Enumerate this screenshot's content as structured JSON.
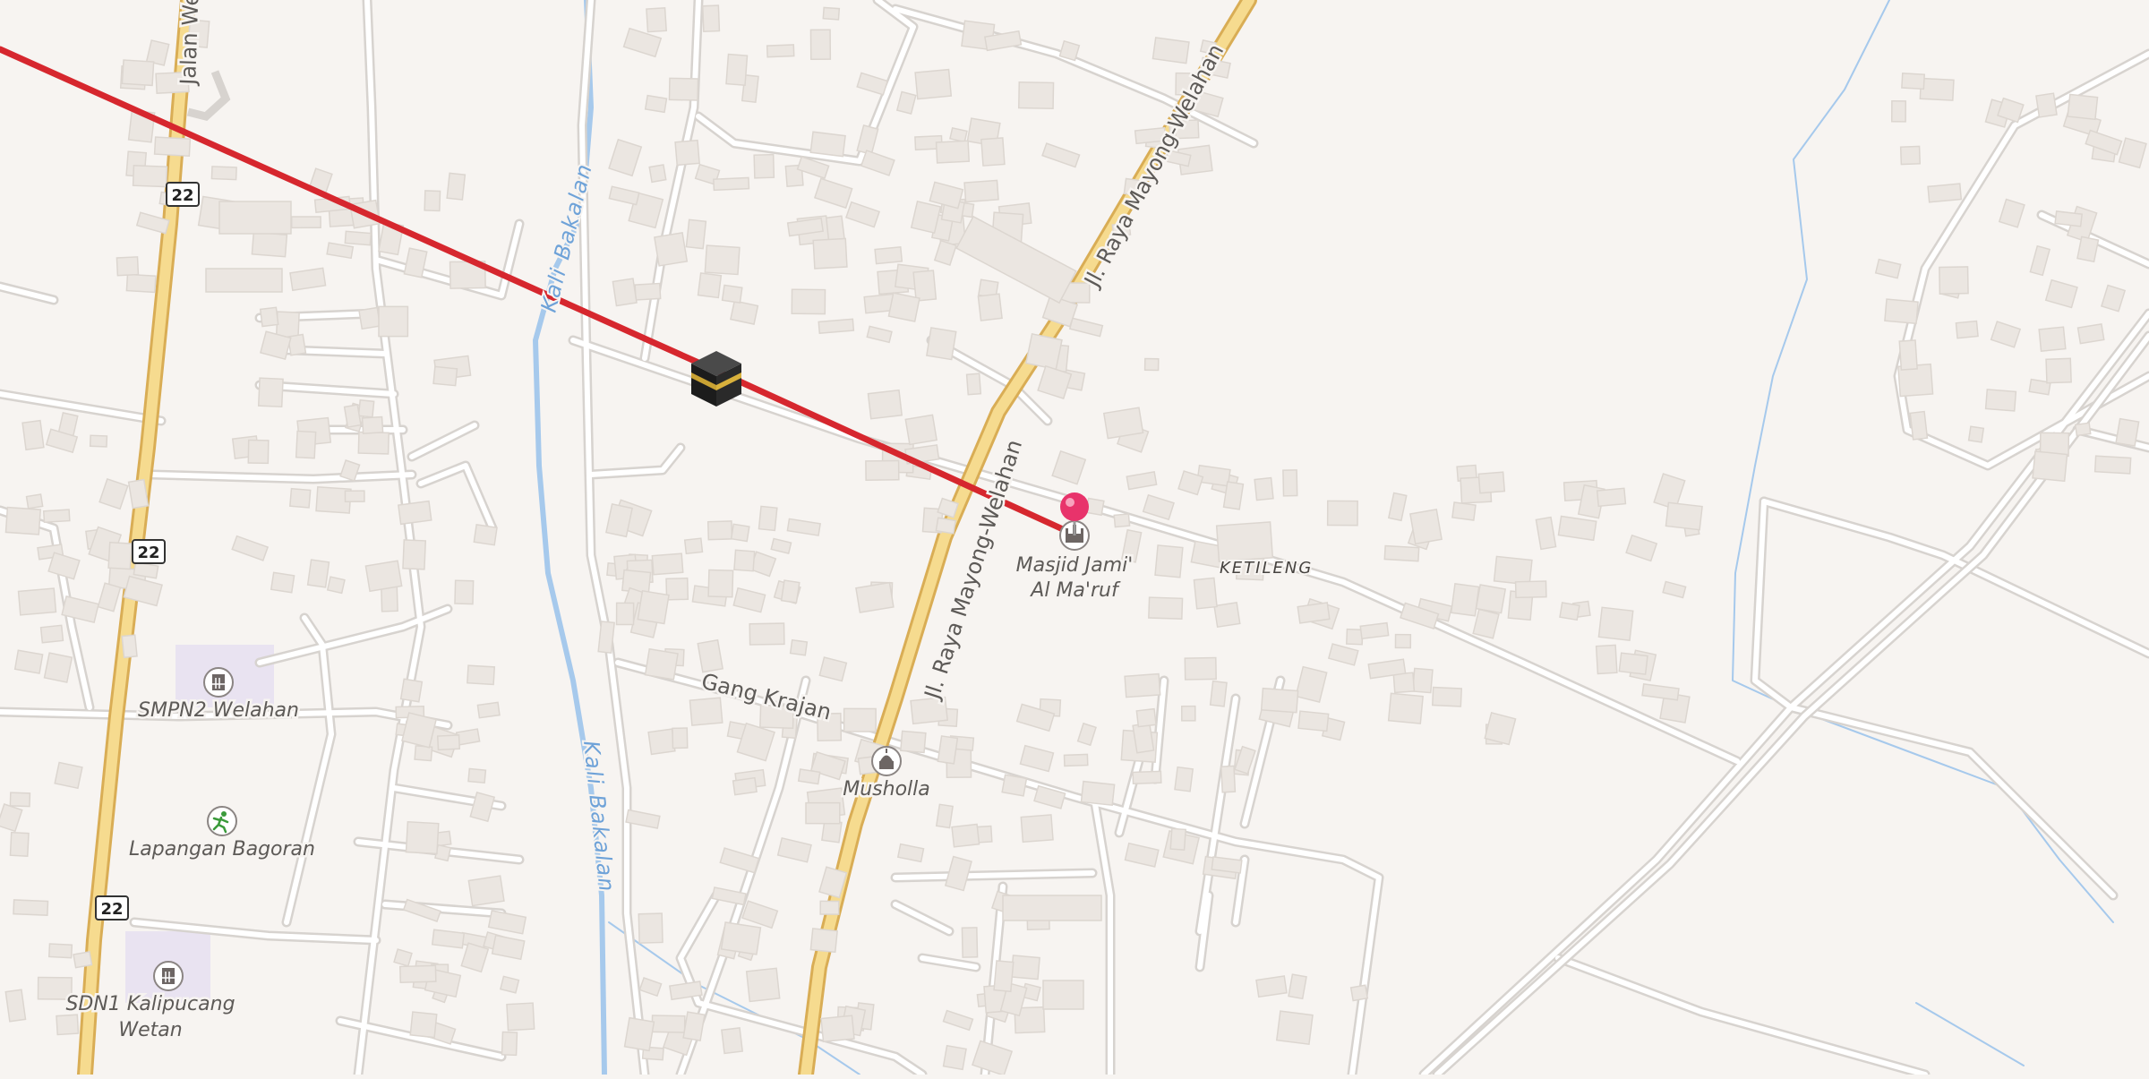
{
  "map": {
    "colors": {
      "background": "#f7f4f1",
      "route_line": "#d6272e",
      "primary_road": "#f6db8f",
      "water": "#a6c9ec",
      "pin": "#e8336b"
    },
    "roads": {
      "jalan_welahan": "Jalan We",
      "jl_raya_north": "Jl. Raya Mayong-Welahan",
      "jl_raya_south": "Jl. Raya Mayong-Welahan",
      "gang_krajan": "Gang Krajan"
    },
    "rivers": {
      "north": "Kali Bakalan",
      "south": "Kali Bakalan"
    },
    "route_shields": [
      "22",
      "22",
      "22"
    ],
    "place": "KETILENG",
    "pois": {
      "masjid_line1": "Masjid Jami'",
      "masjid_line2": "Al Ma'ruf",
      "musholla": "Musholla",
      "smpn2": "SMPN2 Welahan",
      "lapangan": "Lapangan Bagoran",
      "sdn1_line1": "SDN1 Kalipucang",
      "sdn1_line2": "Wetan"
    },
    "icons": {
      "kaaba": "kaaba-icon",
      "pin": "location-pin-icon",
      "mosque": "mosque-icon",
      "school": "school-icon",
      "sports": "sports-field-icon"
    }
  }
}
